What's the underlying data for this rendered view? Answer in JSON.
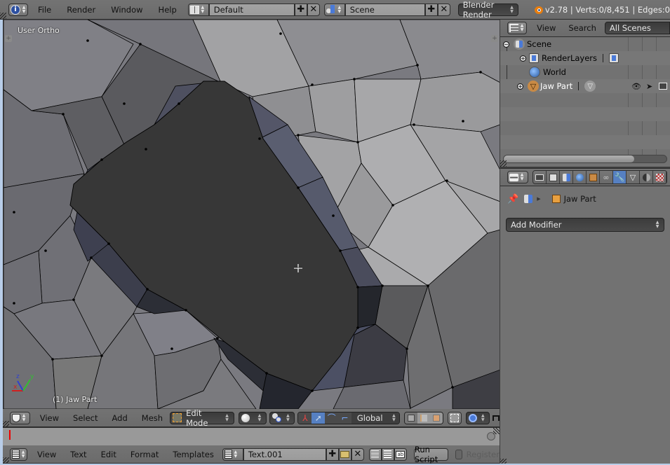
{
  "topbar": {
    "editor_type_icon": "info-icon",
    "menus": [
      "File",
      "Render",
      "Window",
      "Help"
    ],
    "layout_icon": "screen-layout-icon",
    "layout_name": "Default",
    "scene_icon": "scene-icon",
    "scene_name": "Scene",
    "render_engine": "Blender Render",
    "blender_logo": "blender-logo-icon",
    "status": "v2.78 | Verts:0/8,451 | Edges:0"
  },
  "viewport": {
    "view_label": "User Ortho",
    "object_label": "(1) Jaw Part",
    "axis_labels": {
      "x": "x",
      "y": "y",
      "z": "z"
    },
    "colors": {
      "x_axis": "#d02020",
      "y_axis": "#30c030",
      "z_axis": "#3040d0"
    }
  },
  "viewport_header": {
    "editor_icon": "3d-view-icon",
    "menus": [
      "View",
      "Select",
      "Add",
      "Mesh"
    ],
    "mode": "Edit Mode",
    "shading_icon": "solid-shading-icon",
    "pivot_icon": "pivot-point-icon",
    "orientation": "Global",
    "proportional_icon": "proportional-edit-icon"
  },
  "text_editor_header": {
    "editor_icon": "text-editor-icon",
    "menus": [
      "View",
      "Text",
      "Edit",
      "Format",
      "Templates"
    ],
    "text_block": "Text.001",
    "run_script_label": "Run Script",
    "register_label": "Register"
  },
  "outliner": {
    "editor_icon": "outliner-icon",
    "menus": [
      "View",
      "Search"
    ],
    "display_mode": "All Scenes",
    "items": [
      {
        "label": "Scene",
        "icon": "scene-icon",
        "depth": 0,
        "expand": "-"
      },
      {
        "label": "RenderLayers",
        "icon": "render-layers-icon",
        "depth": 1,
        "expand": "+"
      },
      {
        "label": "World",
        "icon": "world-icon",
        "depth": 1,
        "expand": ""
      },
      {
        "label": "Jaw Part",
        "icon": "mesh-object-icon",
        "depth": 1,
        "expand": "+"
      }
    ]
  },
  "properties": {
    "editor_icon": "properties-icon",
    "tabs": [
      "render",
      "render-layers",
      "scene",
      "world",
      "object",
      "constraints",
      "modifiers",
      "data",
      "material",
      "texture"
    ],
    "active_tab": "modifiers",
    "breadcrumb_object": "Jaw Part",
    "add_modifier_label": "Add Modifier"
  }
}
